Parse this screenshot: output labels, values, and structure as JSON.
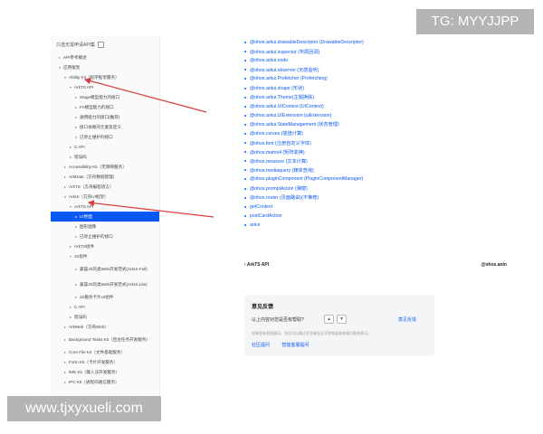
{
  "watermarks": {
    "top": "TG: MYYJJPP",
    "bottom": "www.tjxyxueli.com"
  },
  "sidebar": {
    "filter_label": "只选无需申请API集",
    "items": [
      {
        "label": "API参考概述",
        "level": 0,
        "chev": "▸"
      },
      {
        "label": "应用框架",
        "level": 0,
        "chev": "▾"
      },
      {
        "label": "Ability Kit（程序框架服务）",
        "level": 1,
        "chev": "▾"
      },
      {
        "label": "ArkTS API",
        "level": 2,
        "chev": "▾"
      },
      {
        "label": "Stage模型能力的接口",
        "level": 3,
        "chev": "▸"
      },
      {
        "label": "FA模型能力的接口",
        "level": 3,
        "chev": "▸"
      },
      {
        "label": "通用能力的接口(推荐)",
        "level": 3,
        "chev": "▸"
      },
      {
        "label": "接口依赖的元素及定义",
        "level": 3,
        "chev": "▸"
      },
      {
        "label": "已停止维护的接口",
        "level": 3,
        "chev": "▸"
      },
      {
        "label": "C API",
        "level": 2,
        "chev": "▸"
      },
      {
        "label": "错误码",
        "level": 2,
        "chev": "▸"
      },
      {
        "label": "Accessibility Kit（无障碍服务）",
        "level": 1,
        "chev": "▸"
      },
      {
        "label": "ArkData（方舟数据管理）",
        "level": 1,
        "chev": "▸"
      },
      {
        "label": "ArkTS（方舟编程语言）",
        "level": 1,
        "chev": "▸"
      },
      {
        "label": "ArkUI（方舟UI框架）",
        "level": 1,
        "chev": "▾"
      },
      {
        "label": "ArkTS API",
        "level": 2,
        "chev": "▾"
      },
      {
        "label": "UI界面",
        "level": 3,
        "chev": "▸",
        "selected": true
      },
      {
        "label": "图形图像",
        "level": 3,
        "chev": "▸"
      },
      {
        "label": "已停止维护的接口",
        "level": 3,
        "chev": "▸"
      },
      {
        "label": "ArkTS组件",
        "level": 2,
        "chev": "▸"
      },
      {
        "label": "JS组件",
        "level": 2,
        "chev": "▾"
      },
      {
        "label": "兼容JS的类Web开发范式(ArkUI.Full)",
        "level": 3,
        "chev": "▸",
        "tall": true
      },
      {
        "label": "兼容JS的类Web开发范式(ArkUI.Lite)",
        "level": 3,
        "chev": "▸",
        "tall": true
      },
      {
        "label": "JS服务卡片UI组件",
        "level": 3,
        "chev": "▸"
      },
      {
        "label": "C API",
        "level": 2,
        "chev": "▸"
      },
      {
        "label": "错误码",
        "level": 2,
        "chev": "▸"
      },
      {
        "label": "ArkWeb（方舟Web）",
        "level": 1,
        "chev": "▸"
      },
      {
        "label": "Background Tasks Kit（后台任务开发服务）",
        "level": 1,
        "chev": "▸",
        "tall": true
      },
      {
        "label": "Core File Kit（文件基础服务）",
        "level": 1,
        "chev": "▸"
      },
      {
        "label": "Form Kit（卡片开发服务）",
        "level": 1,
        "chev": "▸"
      },
      {
        "label": "IME Kit（输入法开发服务）",
        "level": 1,
        "chev": "▸"
      },
      {
        "label": "IPC Kit（进程间通信服务）",
        "level": 1,
        "chev": "▸"
      }
    ]
  },
  "api_list": [
    "@ohos.arkui.drawableDescriptor (DrawableDescriptor)",
    "@ohos.arkui.inspector (布局回调)",
    "@ohos.arkui.node",
    "@ohos.arkui.observer (无感监听)",
    "@ohos.arkui.Prefetcher (Prefetching)",
    "@ohos.arkui.shape (形状)",
    "@ohos.arkui.Theme(主题换肤)",
    "@ohos.arkui.UIContext (UIContext)",
    "@ohos.arkui.UIExtension (uiExtension)",
    "@ohos.arkui.StateManagement (状态管理)",
    "@ohos.curves (插值计算)",
    "@ohos.font (注册自定义字体)",
    "@ohos.matrix4 (矩阵变换)",
    "@ohos.measure (文本计算)",
    "@ohos.mediaquery (媒体查询)",
    "@ohos.pluginComponent (PluginComponentManager)",
    "@ohos.promptAction (弹窗)",
    "@ohos.router (页面路由)(不推荐)",
    "getContext",
    "postCardAction",
    "arkui"
  ],
  "pager": {
    "prev_label": "ArkTS API",
    "next_label": "@ohos.anin"
  },
  "feedback": {
    "title": "意见反馈",
    "question": "以上内容对您是否有帮助?",
    "report_label": "意见反馈",
    "description": "如果您有其他疑问，您也可以通过开发者社区问答频道来和我们联系探讨。",
    "link_community": "社区提问",
    "link_service": "智能客服提问"
  },
  "colors": {
    "link": "#0a59f7",
    "arrow": "#d64040"
  }
}
